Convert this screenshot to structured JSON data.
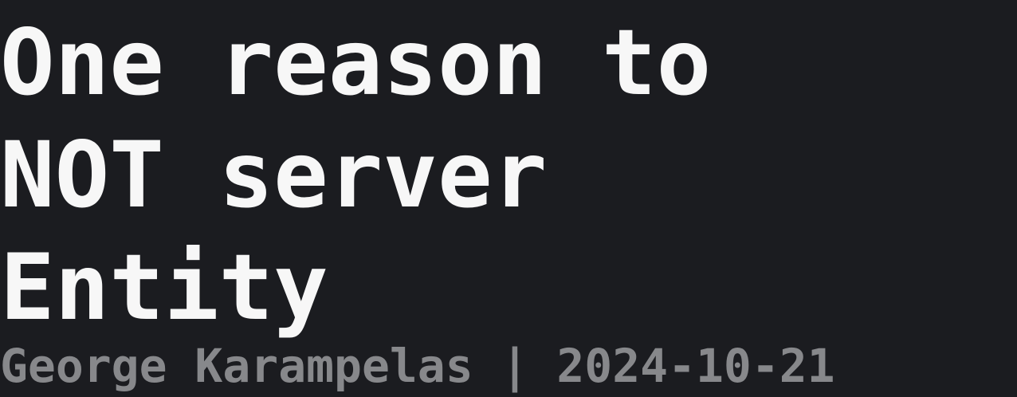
{
  "title": {
    "lines": [
      "One reason to",
      "NOT server",
      "Entity"
    ]
  },
  "byline": {
    "author": "George Karampelas",
    "separator": "|",
    "date": "2024-10-21"
  },
  "colors": {
    "background": "#1b1c20",
    "title": "#f7f7f7",
    "byline": "#87888b"
  }
}
